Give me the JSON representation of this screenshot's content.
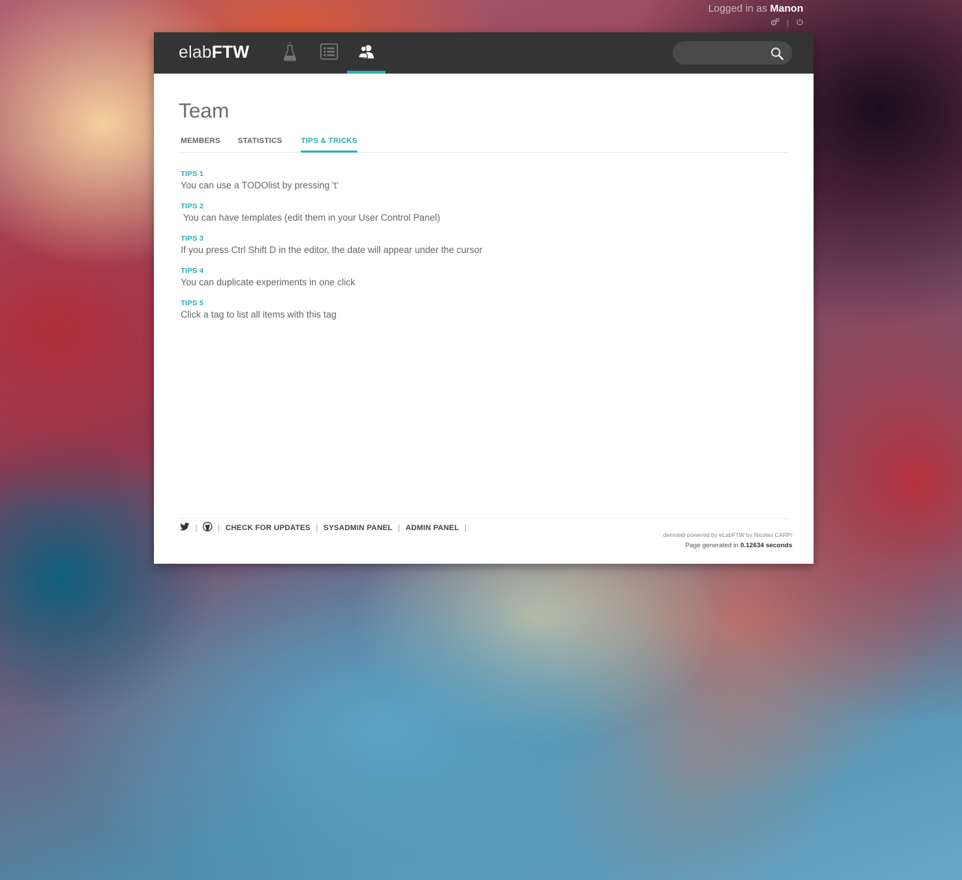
{
  "user": {
    "logged_in_prefix": "Logged in as",
    "name": "Manon"
  },
  "navbar": {
    "logo_light": "elab",
    "logo_bold": "FTW",
    "items": [
      {
        "icon": "flask-icon",
        "active": false
      },
      {
        "icon": "list-icon",
        "active": false
      },
      {
        "icon": "team-icon",
        "active": true
      }
    ],
    "search": {
      "value": "",
      "placeholder": ""
    }
  },
  "page": {
    "title": "Team",
    "tabs": [
      {
        "label": "MEMBERS",
        "active": false
      },
      {
        "label": "STATISTICS",
        "active": false
      },
      {
        "label": "TIPS & TRICKS",
        "active": true
      }
    ]
  },
  "tips": [
    {
      "title": "TIPS 1",
      "text": "You can use a TODOlist by pressing 't'"
    },
    {
      "title": "TIPS 2",
      "text": " You can have templates (edit them in your User Control Panel)"
    },
    {
      "title": "TIPS 3",
      "text": "If you press Ctrl Shift D in the editor, the date will appear under the cursor"
    },
    {
      "title": "TIPS 4",
      "text": "You can duplicate experiments in one click"
    },
    {
      "title": "TIPS 5",
      "text": "Click a tag to list all items with this tag"
    }
  ],
  "footer": {
    "links": [
      "CHECK FOR UPDATES",
      "SYSADMIN PANEL",
      "ADMIN PANEL"
    ],
    "powered_by": "demolab powered by eLabFTW by Nicolas CARPi",
    "generated_prefix": "Page generated in",
    "generated_time": "0.12634 seconds"
  },
  "colors": {
    "accent": "#29aeb9",
    "navbar": "#343434",
    "text": "#666666"
  }
}
